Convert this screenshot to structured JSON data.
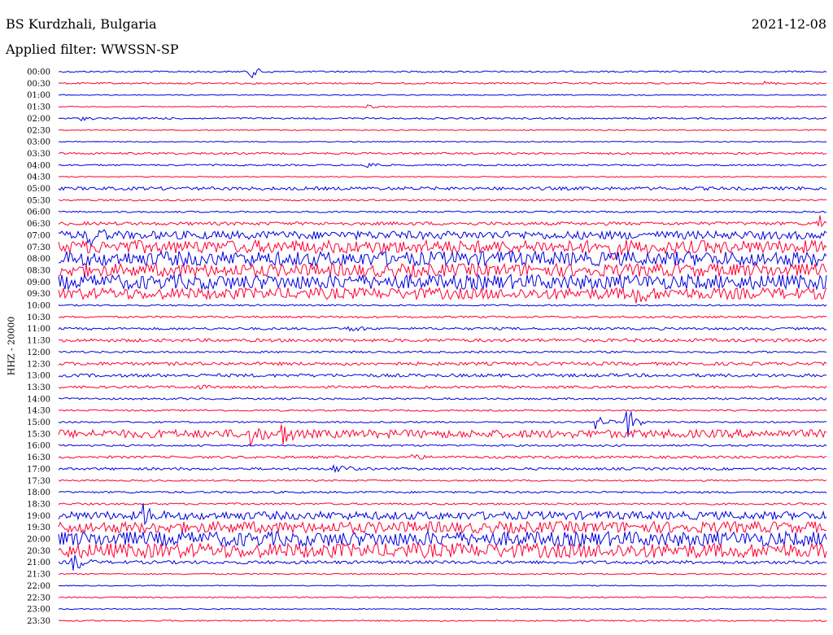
{
  "header": {
    "station": "BS Kurdzhali, Bulgaria",
    "filter": "Applied filter: WWSSN-SP",
    "date": "2021-12-08"
  },
  "chart_data": {
    "type": "line",
    "ylabel": "HHZ - 20000",
    "colors": [
      "#0000dd",
      "#ff0033"
    ],
    "rows": [
      {
        "label": "00:00",
        "amp": 1,
        "events": [
          {
            "x": 0.25,
            "amp": 8
          }
        ]
      },
      {
        "label": "00:30",
        "amp": 1,
        "events": [
          {
            "x": 0.92,
            "amp": 2
          }
        ]
      },
      {
        "label": "01:00",
        "amp": 0.6,
        "events": []
      },
      {
        "label": "01:30",
        "amp": 0.6,
        "events": [
          {
            "x": 0.4,
            "amp": 3
          }
        ]
      },
      {
        "label": "02:00",
        "amp": 1,
        "events": [
          {
            "x": 0.03,
            "amp": 2
          },
          {
            "x": 0.12,
            "amp": 2
          }
        ]
      },
      {
        "label": "02:30",
        "amp": 0.6,
        "events": []
      },
      {
        "label": "03:00",
        "amp": 0.6,
        "events": []
      },
      {
        "label": "03:30",
        "amp": 1.2,
        "events": []
      },
      {
        "label": "04:00",
        "amp": 1,
        "events": [
          {
            "x": 0.4,
            "amp": 6
          }
        ]
      },
      {
        "label": "04:30",
        "amp": 0.6,
        "events": []
      },
      {
        "label": "05:00",
        "amp": 2,
        "events": []
      },
      {
        "label": "05:30",
        "amp": 1,
        "events": []
      },
      {
        "label": "06:00",
        "amp": 1,
        "events": []
      },
      {
        "label": "06:30",
        "amp": 2,
        "events": [
          {
            "x": 0.99,
            "amp": 12
          }
        ]
      },
      {
        "label": "07:00",
        "amp": 5,
        "events": [
          {
            "x": 0.04,
            "amp": 14
          }
        ]
      },
      {
        "label": "07:30",
        "amp": 8,
        "events": [
          {
            "x": 0.72,
            "amp": 10
          }
        ]
      },
      {
        "label": "08:00",
        "amp": 9,
        "events": []
      },
      {
        "label": "08:30",
        "amp": 8,
        "events": []
      },
      {
        "label": "09:00",
        "amp": 9,
        "events": []
      },
      {
        "label": "09:30",
        "amp": 7,
        "events": [
          {
            "x": 0.75,
            "amp": 12
          }
        ]
      },
      {
        "label": "10:00",
        "amp": 1,
        "events": []
      },
      {
        "label": "10:30",
        "amp": 1.2,
        "events": []
      },
      {
        "label": "11:00",
        "amp": 1.5,
        "events": [
          {
            "x": 0.38,
            "amp": 5
          }
        ]
      },
      {
        "label": "11:30",
        "amp": 2,
        "events": []
      },
      {
        "label": "12:00",
        "amp": 1.2,
        "events": []
      },
      {
        "label": "12:30",
        "amp": 2,
        "events": []
      },
      {
        "label": "13:00",
        "amp": 2,
        "events": []
      },
      {
        "label": "13:30",
        "amp": 1.5,
        "events": [
          {
            "x": 0.18,
            "amp": 3
          }
        ]
      },
      {
        "label": "14:00",
        "amp": 1.2,
        "events": []
      },
      {
        "label": "14:30",
        "amp": 1,
        "events": []
      },
      {
        "label": "15:00",
        "amp": 1,
        "events": [
          {
            "x": 0.7,
            "amp": 12
          },
          {
            "x": 0.74,
            "amp": 22
          }
        ]
      },
      {
        "label": "15:30",
        "amp": 5,
        "events": [
          {
            "x": 0.25,
            "amp": 12
          },
          {
            "x": 0.29,
            "amp": 14
          }
        ]
      },
      {
        "label": "16:00",
        "amp": 1.2,
        "events": []
      },
      {
        "label": "16:30",
        "amp": 1.5,
        "events": [
          {
            "x": 0.46,
            "amp": 4
          }
        ]
      },
      {
        "label": "17:00",
        "amp": 1.5,
        "events": [
          {
            "x": 0.36,
            "amp": 10
          }
        ]
      },
      {
        "label": "17:30",
        "amp": 1,
        "events": []
      },
      {
        "label": "18:00",
        "amp": 1.2,
        "events": []
      },
      {
        "label": "18:30",
        "amp": 1.2,
        "events": []
      },
      {
        "label": "19:00",
        "amp": 5,
        "events": [
          {
            "x": 0.11,
            "amp": 12
          }
        ]
      },
      {
        "label": "19:30",
        "amp": 7,
        "events": []
      },
      {
        "label": "20:00",
        "amp": 9,
        "events": []
      },
      {
        "label": "20:30",
        "amp": 9,
        "events": []
      },
      {
        "label": "21:00",
        "amp": 2,
        "events": [
          {
            "x": 0.02,
            "amp": 13
          }
        ]
      },
      {
        "label": "21:30",
        "amp": 0.8,
        "events": []
      },
      {
        "label": "22:00",
        "amp": 0.6,
        "events": []
      },
      {
        "label": "22:30",
        "amp": 0.8,
        "events": []
      },
      {
        "label": "23:00",
        "amp": 0.6,
        "events": []
      },
      {
        "label": "23:30",
        "amp": 0.8,
        "events": []
      }
    ]
  }
}
